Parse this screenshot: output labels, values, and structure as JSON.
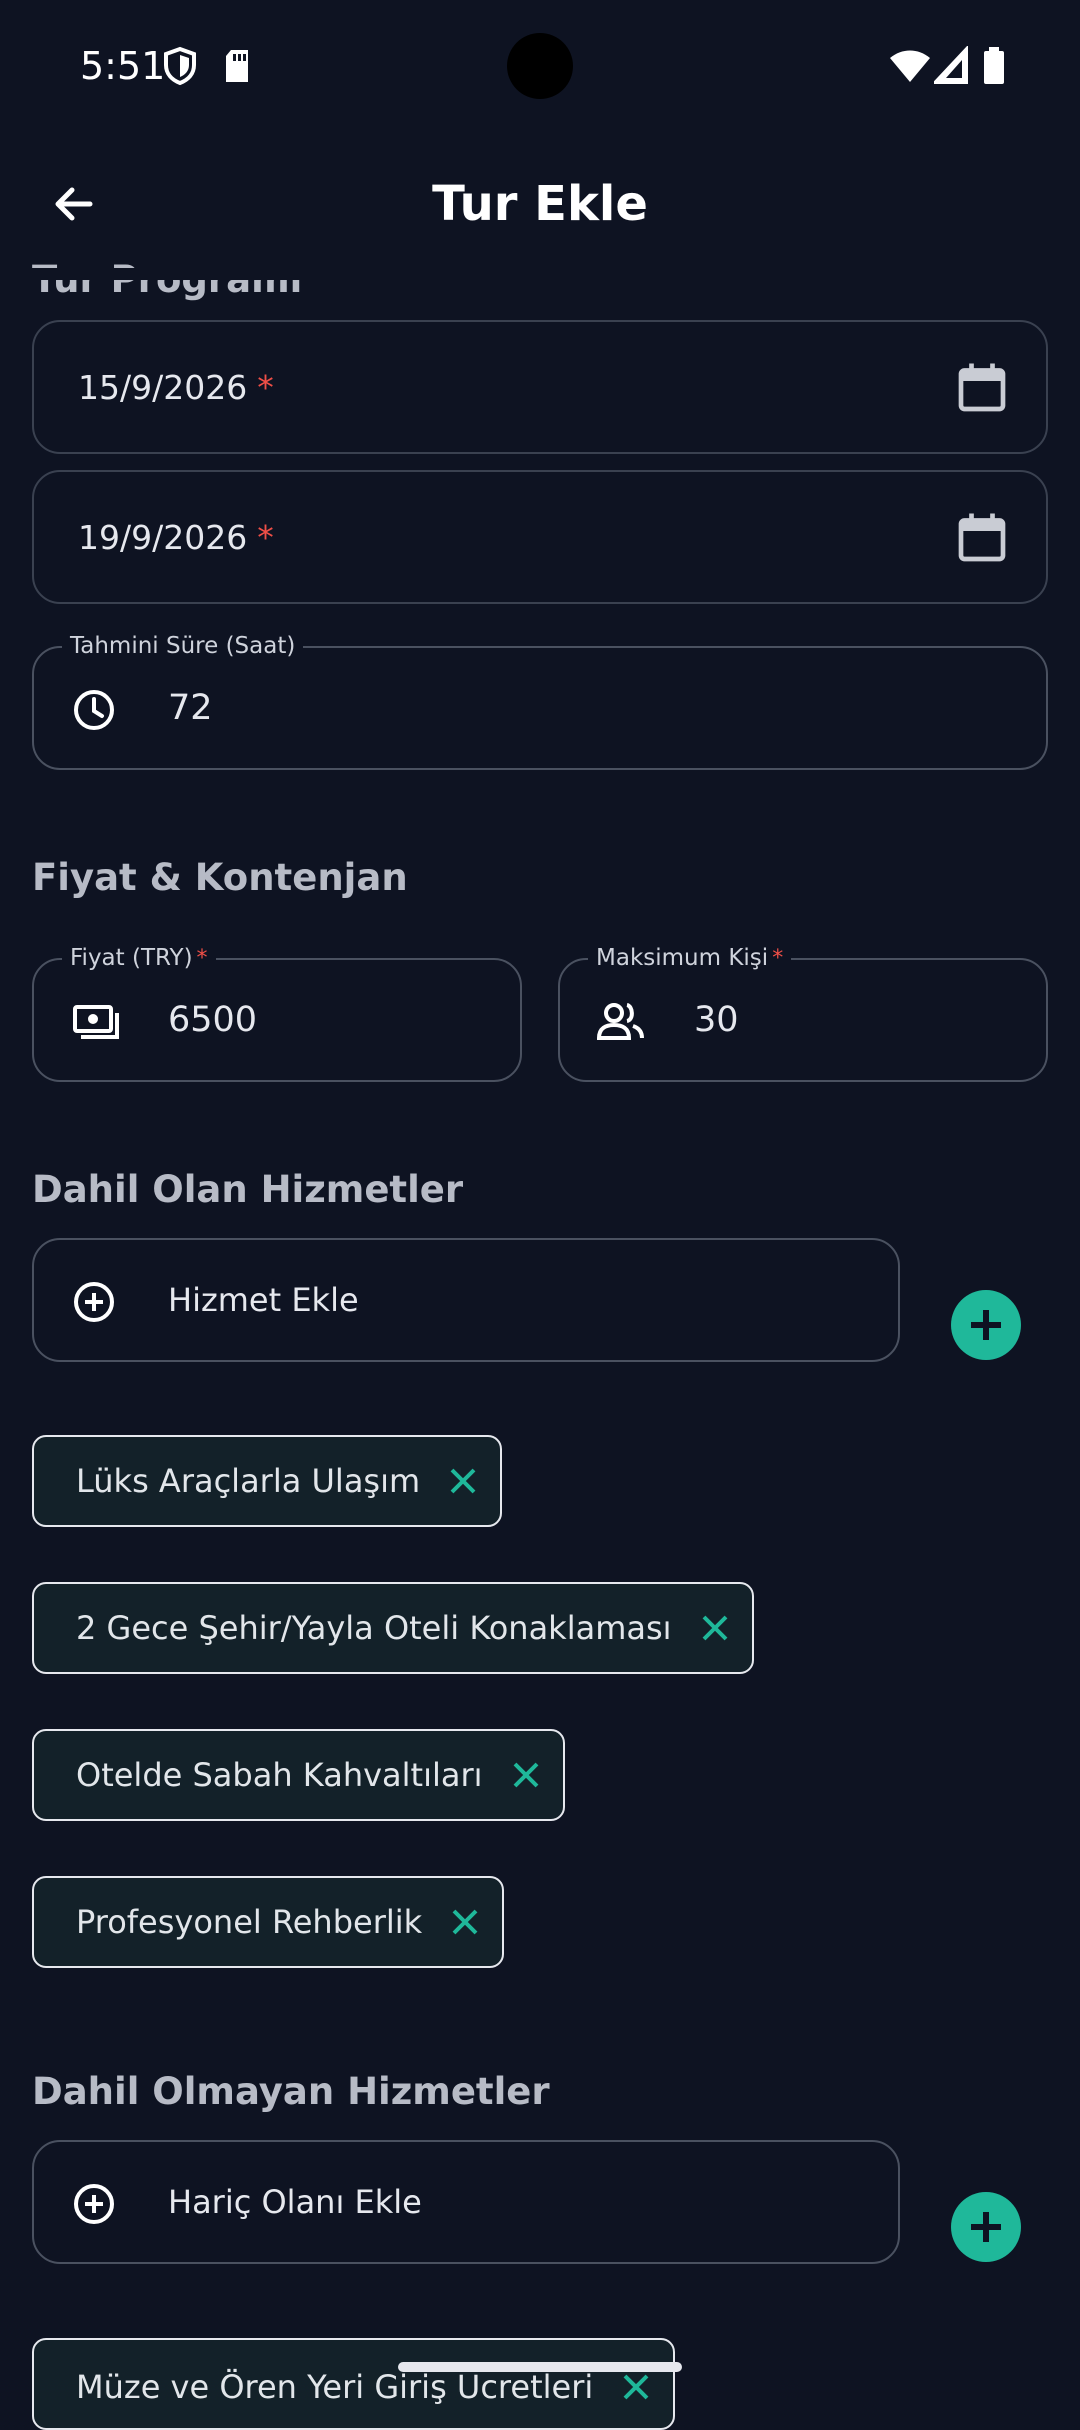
{
  "status_bar": {
    "time": "5:51"
  },
  "app_bar": {
    "title": "Tur Ekle"
  },
  "tour_program": {
    "section_title": "Tur Programı",
    "start_date": "15/9/2026",
    "end_date": "19/9/2026",
    "required_mark": "*",
    "duration_label": "Tahmini Süre (Saat)",
    "duration_value": "72"
  },
  "pricing": {
    "section_title": "Fiyat & Kontenjan",
    "price_label": "Fiyat (TRY)",
    "price_value": "6500",
    "max_people_label": "Maksimum Kişi",
    "max_people_value": "30",
    "required_mark": "*"
  },
  "included": {
    "section_title": "Dahil Olan Hizmetler",
    "add_placeholder": "Hizmet Ekle",
    "items": [
      "Lüks Araçlarla Ulaşım",
      "2 Gece Şehir/Yayla Oteli Konaklaması",
      "Otelde Sabah Kahvaltıları",
      "Profesyonel Rehberlik"
    ]
  },
  "excluded": {
    "section_title": "Dahil Olmayan Hizmetler",
    "add_placeholder": "Hariç Olanı Ekle",
    "items": [
      "Müze ve Ören Yeri Giriş Ücretleri"
    ]
  },
  "colors": {
    "background": "#0e1322",
    "accent": "#1fb89a",
    "required": "#ef4f47"
  },
  "icons": [
    "shield-icon",
    "sd-card-icon",
    "wifi-icon",
    "signal-icon",
    "battery-icon",
    "back-arrow-icon",
    "calendar-icon",
    "clock-icon",
    "cash-icon",
    "people-icon",
    "add-circle-icon",
    "close-icon",
    "plus-icon"
  ]
}
